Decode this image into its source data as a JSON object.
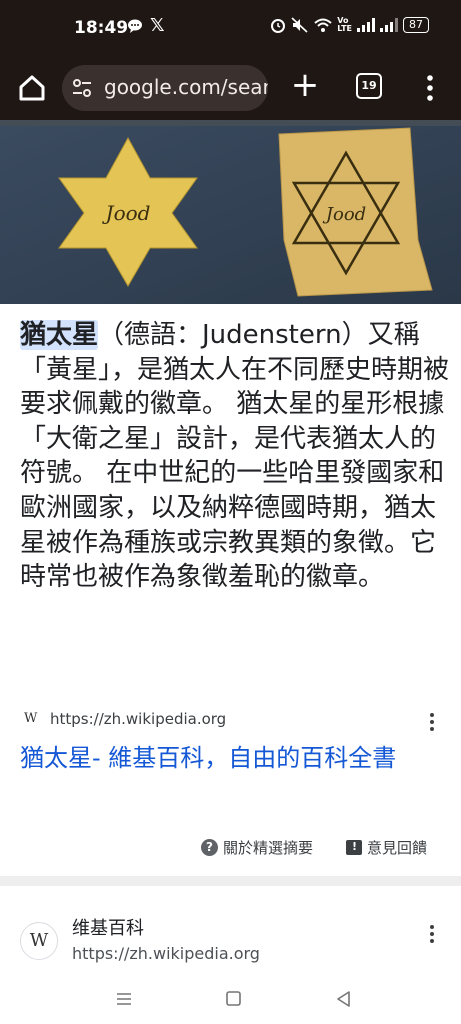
{
  "status_bar": {
    "time": "18:49",
    "battery": "87",
    "notification_icons": [
      "chat-bubble-icon",
      "x-logo-icon"
    ],
    "system_icons": [
      "alarm-icon",
      "mute-icon",
      "wifi-icon",
      "volte-icon",
      "signal-icon",
      "signal-icon",
      "battery-icon"
    ]
  },
  "browser": {
    "url": "google.com/sear",
    "tab_count": "19",
    "toolbar_color": "#1f1714"
  },
  "article": {
    "highlight": "猶太星",
    "text": "（德語：Judenstern）又稱「黃星」，是猶太人在不同歷史時期被要求佩戴的徽章。 猶太星的星形根據「大衛之星」設計，是代表猶太人的符號。 在中世紀的一些哈里發國家和歐洲國家，以及納粹德國時期，猶太星被作為種族或宗教異類的象徵。它時常也被作為象徵羞恥的徽章。"
  },
  "source": {
    "url": "https://zh.wikipedia.org",
    "title": "猶太星- 維基百科，自由的百科全書"
  },
  "footer": {
    "about_label": "關於精選摘要",
    "feedback_label": "意見回饋"
  },
  "result2": {
    "site_name": "维基百科",
    "url": "https://zh.wikipedia.org"
  },
  "colors": {
    "link": "#1558d6",
    "highlight_bg": "#d3e3fd",
    "star_yellow": "#e8c44a",
    "hero_bg": "#324257"
  }
}
